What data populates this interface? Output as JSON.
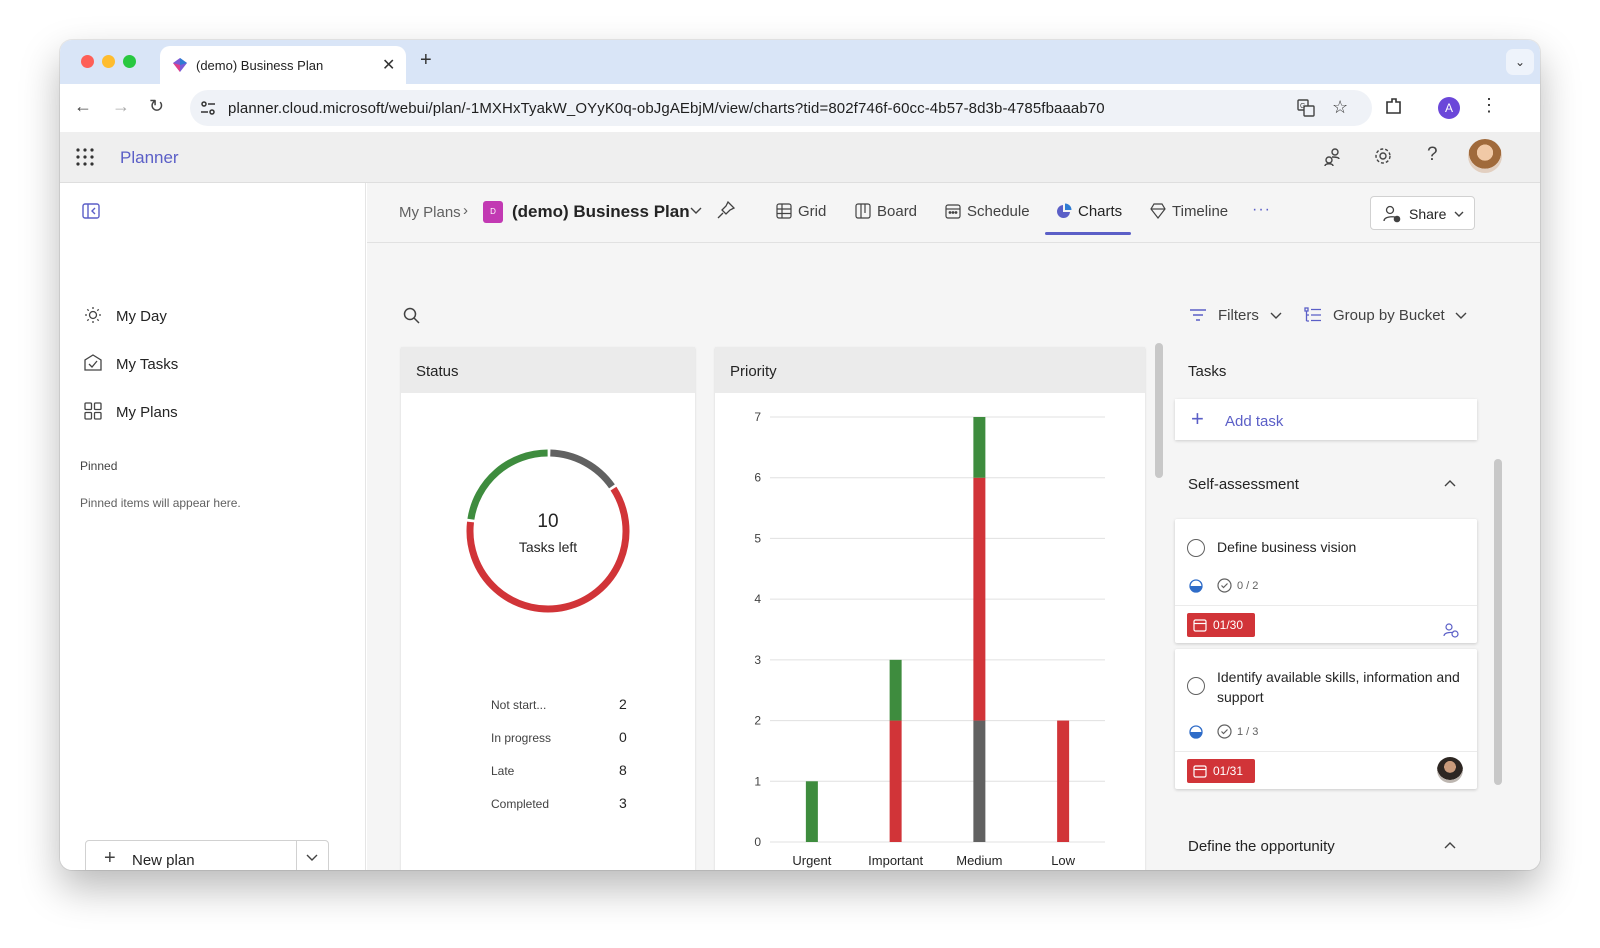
{
  "browser": {
    "tab_title": "(demo) Business Plan",
    "url": "planner.cloud.microsoft/webui/plan/-1MXHxTyakW_OYyK0q-obJgAEbjM/view/charts?tid=802f746f-60cc-4b57-8d3b-4785fbaaab70",
    "profile_initial": "A"
  },
  "app": {
    "name": "Planner"
  },
  "sidebar": {
    "items": [
      {
        "label": "My Day",
        "icon": "sun-icon"
      },
      {
        "label": "My Tasks",
        "icon": "tasks-icon"
      },
      {
        "label": "My Plans",
        "icon": "plans-grid-icon"
      }
    ],
    "pinned_heading": "Pinned",
    "pinned_empty": "Pinned items will appear here.",
    "new_plan": "New plan"
  },
  "header": {
    "breadcrumb_root": "My Plans",
    "plan_badge": "D",
    "plan_name": "(demo) Business Plan",
    "views": [
      "Grid",
      "Board",
      "Schedule",
      "Charts",
      "Timeline"
    ],
    "active_view": "Charts",
    "more": "···",
    "share": "Share"
  },
  "toolbar": {
    "filters": "Filters",
    "group_by": "Group by Bucket"
  },
  "status_card": {
    "title": "Status",
    "center_value": "10",
    "center_label": "Tasks left",
    "rows": [
      {
        "label": "Not start...",
        "value": "2"
      },
      {
        "label": "In progress",
        "value": "0"
      },
      {
        "label": "Late",
        "value": "8"
      },
      {
        "label": "Completed",
        "value": "3"
      }
    ]
  },
  "priority_card": {
    "title": "Priority"
  },
  "tasks_panel": {
    "title": "Tasks",
    "add_task": "Add task",
    "buckets": [
      {
        "name": "Self-assessment",
        "tasks": [
          {
            "title": "Define business vision",
            "checklist": "0 / 2",
            "due": "01/30"
          },
          {
            "title": "Identify available skills, information and support",
            "checklist": "1 / 3",
            "due": "01/31"
          }
        ]
      },
      {
        "name": "Define the opportunity",
        "tasks": []
      }
    ]
  },
  "colors": {
    "accent": "#5b5fc7",
    "completed": "#3e8c3e",
    "late": "#d13438",
    "not_started": "#616161",
    "badge": "#c239b3"
  },
  "chart_data": [
    {
      "type": "pie",
      "title": "Status",
      "labels": [
        "Not started",
        "In progress",
        "Late",
        "Completed"
      ],
      "values": [
        2,
        0,
        8,
        3
      ],
      "colors": [
        "#616161",
        "#2f7cd3",
        "#d13438",
        "#3e8c3e"
      ],
      "donut": true
    },
    {
      "type": "bar",
      "stacked": true,
      "title": "Priority",
      "categories": [
        "Urgent",
        "Important",
        "Medium",
        "Low"
      ],
      "series": [
        {
          "name": "Not started",
          "values": [
            0,
            0,
            2,
            0
          ],
          "color": "#616161"
        },
        {
          "name": "Late",
          "values": [
            0,
            2,
            4,
            2
          ],
          "color": "#d13438"
        },
        {
          "name": "Completed",
          "values": [
            1,
            1,
            1,
            0
          ],
          "color": "#3e8c3e"
        }
      ],
      "ylim": [
        0,
        7
      ],
      "yticks": [
        0,
        1,
        2,
        3,
        4,
        5,
        6,
        7
      ],
      "grid": true
    }
  ]
}
